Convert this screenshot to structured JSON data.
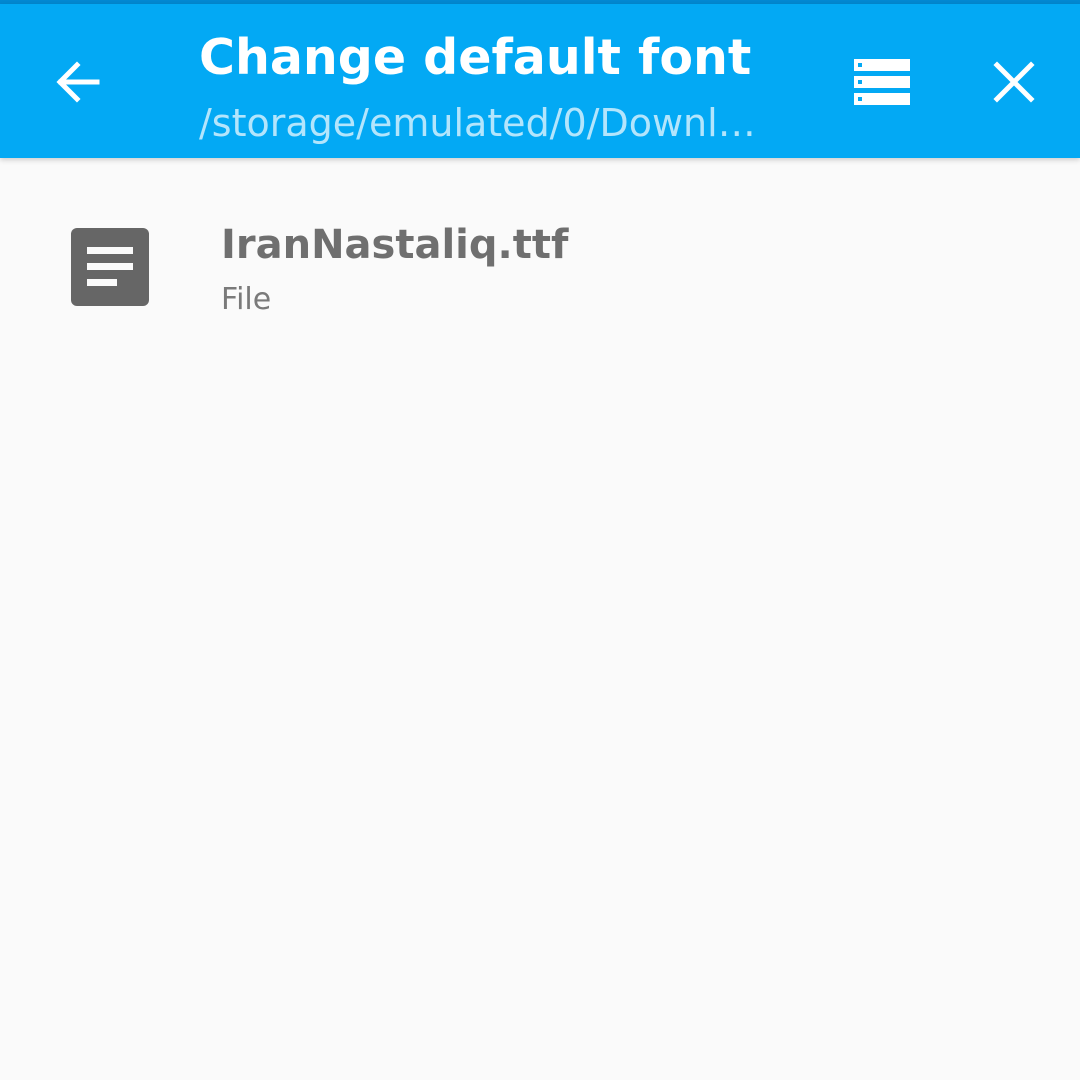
{
  "header": {
    "title": "Change default font",
    "subtitle": "/storage/emulated/0/Downl…",
    "back_icon": "arrow-back-icon",
    "storage_icon": "storage-list-icon",
    "close_icon": "close-icon"
  },
  "files": [
    {
      "name": "IranNastaliq.ttf",
      "type": "File",
      "icon": "document-icon"
    }
  ],
  "colors": {
    "appbar": "#03a9f4",
    "statusline": "#0288d1",
    "background": "#fafafa",
    "subtitle": "#b3e5fc",
    "file_icon": "#666666",
    "file_name": "#6f6f6f"
  }
}
